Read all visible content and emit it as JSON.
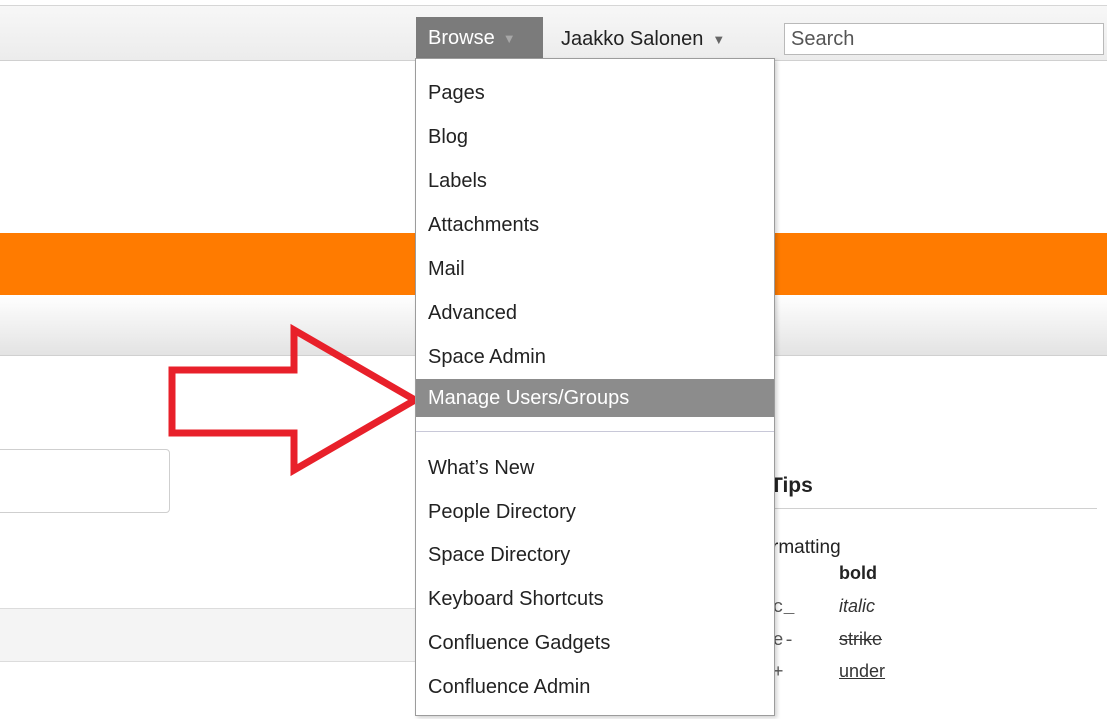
{
  "header": {
    "browse_label": "Browse",
    "user_name": "Jaakko Salonen",
    "search_placeholder": "Search"
  },
  "browse_menu": {
    "section1": [
      {
        "label": "Pages"
      },
      {
        "label": "Blog"
      },
      {
        "label": "Labels"
      },
      {
        "label": "Attachments"
      },
      {
        "label": "Mail"
      },
      {
        "label": "Advanced"
      },
      {
        "label": "Space Admin"
      },
      {
        "label": "Manage Users/Groups",
        "highlighted": true
      }
    ],
    "section2": [
      {
        "label": "What’s New"
      },
      {
        "label": "People Directory"
      },
      {
        "label": "Space Directory"
      },
      {
        "label": "Keyboard Shortcuts"
      },
      {
        "label": "Confluence Gadgets"
      },
      {
        "label": "Confluence Admin"
      }
    ]
  },
  "tips": {
    "title": "Tips",
    "formatting_label": "rmatting",
    "rows": [
      {
        "code": "*",
        "sample": "bold"
      },
      {
        "code": "ic_",
        "sample": "italic"
      },
      {
        "code": "ke-",
        "sample": "strike"
      },
      {
        "code": "r+",
        "sample": "under"
      }
    ]
  },
  "colors": {
    "orange_band": "#ff7b00",
    "menu_highlight": "#8c8c8c",
    "annotation_arrow": "#e8202a"
  },
  "icons": {
    "browse_caret": "caret-down-icon",
    "user_caret": "caret-down-icon",
    "annotation": "arrow-right-icon"
  }
}
